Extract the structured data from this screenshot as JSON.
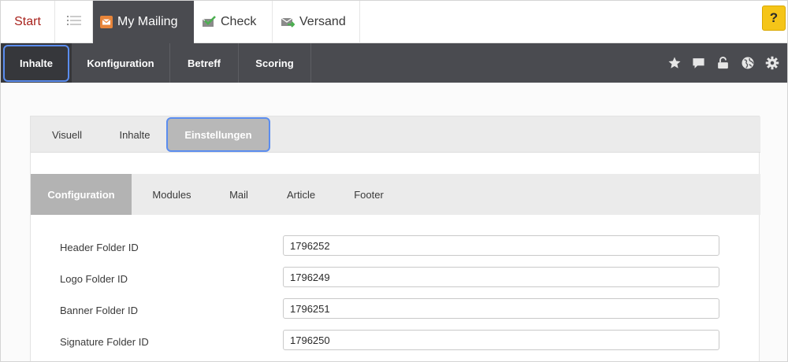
{
  "top_tabs": {
    "start": "Start",
    "list_icon": "list-icon",
    "mailing": {
      "label": "My Mailing",
      "icon": "envelope-icon"
    },
    "check": {
      "label": "Check",
      "icon": "checkmark-envelope-icon"
    },
    "versand": {
      "label": "Versand",
      "icon": "send-envelope-icon"
    },
    "help": "?"
  },
  "nav": {
    "items": [
      "Inhalte",
      "Konfiguration",
      "Betreff",
      "Scoring"
    ],
    "icons": [
      "star-icon",
      "comment-icon",
      "unlock-icon",
      "globe-icon",
      "gear-icon"
    ]
  },
  "sub_tabs": [
    "Visuell",
    "Inhalte",
    "Einstellungen"
  ],
  "config_tabs": [
    "Configuration",
    "Modules",
    "Mail",
    "Article",
    "Footer"
  ],
  "fields": [
    {
      "label": "Header Folder ID",
      "value": "1796252"
    },
    {
      "label": "Logo Folder ID",
      "value": "1796249"
    },
    {
      "label": "Banner Folder ID",
      "value": "1796251"
    },
    {
      "label": "Signature Folder ID",
      "value": "1796250"
    }
  ],
  "colors": {
    "accent_dark": "#4a4b50",
    "start_red": "#a8231d",
    "help_yellow": "#f5c518",
    "focus_blue": "#5b8def"
  }
}
